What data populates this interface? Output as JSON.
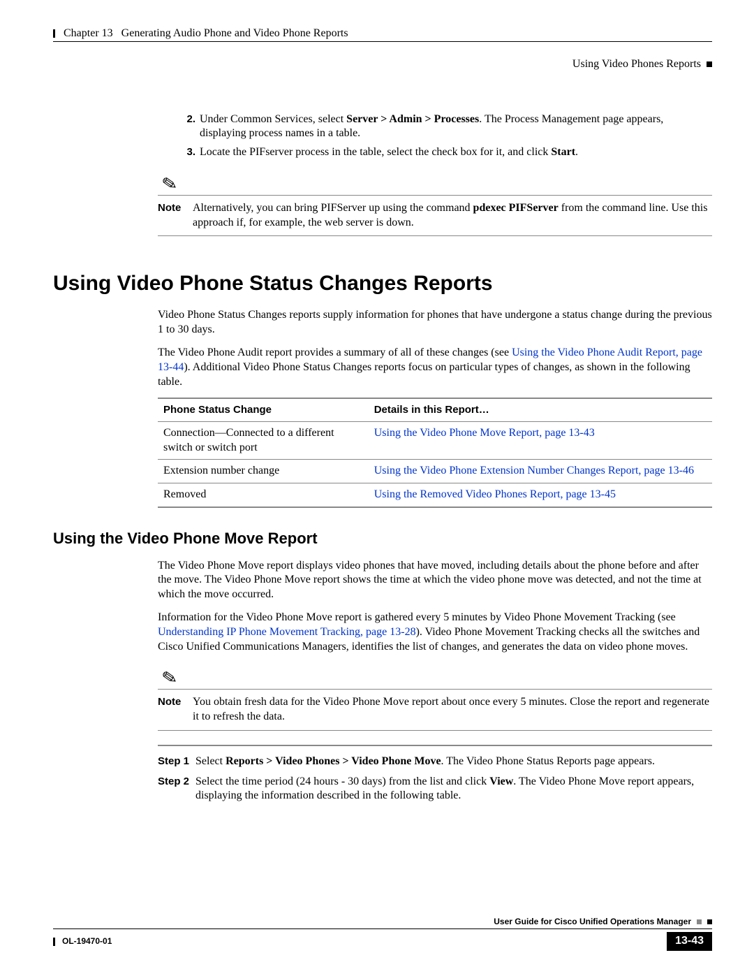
{
  "header": {
    "chapter_label": "Chapter 13",
    "chapter_title": "Generating Audio Phone and Video Phone Reports",
    "section_right": "Using Video Phones Reports"
  },
  "ordered_steps": {
    "s2_num": "2.",
    "s2_pre": "Under Common Services, select ",
    "s2_bold": "Server > Admin > Processes",
    "s2_post": ". The Process Management page appears, displaying process names in a table.",
    "s3_num": "3.",
    "s3_pre": "Locate the PIFserver process in the table, select the check box for it, and click ",
    "s3_bold": "Start",
    "s3_post": "."
  },
  "note1": {
    "label": "Note",
    "text_pre": "Alternatively, you can bring PIFServer up using the command ",
    "text_bold": "pdexec PIFServer",
    "text_post": " from the command line. Use this approach if, for example, the web server is down."
  },
  "h1": "Using Video Phone Status Changes Reports",
  "p1": "Video Phone Status Changes reports supply information for phones that have undergone a status change during the previous 1 to 30 days.",
  "p2_pre": "The Video Phone Audit report provides a summary of all of these changes (see ",
  "p2_link": "Using the Video Phone Audit Report, page 13-44",
  "p2_post": "). Additional Video Phone Status Changes reports focus on particular types of changes, as shown in the following table.",
  "table": {
    "h1": "Phone Status Change",
    "h2": "Details in this Report…",
    "r1c1": "Connection—Connected to a different switch or switch port",
    "r1c2": "Using the Video Phone Move Report, page 13-43",
    "r2c1": "Extension number change",
    "r2c2": "Using the Video Phone Extension Number Changes Report, page 13-46",
    "r3c1": "Removed",
    "r3c2": "Using the Removed Video Phones Report, page 13-45"
  },
  "h2": "Using the Video Phone Move Report",
  "p3": "The Video Phone Move report displays video phones that have moved, including details about the phone before and after the move. The Video Phone Move report shows the time at which the video phone move was detected, and not the time at which the move occurred.",
  "p4_pre": "Information for the Video Phone Move report is gathered every 5 minutes by Video Phone Movement Tracking (see ",
  "p4_link": "Understanding IP Phone Movement Tracking, page 13-28",
  "p4_post": "). Video Phone Movement Tracking checks all the switches and Cisco Unified Communications Managers, identifies the list of changes, and generates the data on video phone moves.",
  "note2": {
    "label": "Note",
    "text": "You obtain fresh data for the Video Phone Move report about once every 5 minutes. Close the report and regenerate it to refresh the data."
  },
  "steps": {
    "s1_label": "Step 1",
    "s1_pre": "Select ",
    "s1_bold": "Reports > Video Phones > Video Phone Move",
    "s1_post": ". The Video Phone Status Reports page appears.",
    "s2_label": "Step 2",
    "s2_pre": "Select the time period (24 hours - 30 days) from the list and click ",
    "s2_bold": "View",
    "s2_post": ". The Video Phone Move report appears, displaying the information described in the following table."
  },
  "footer": {
    "guide": "User Guide for Cisco Unified Operations Manager",
    "docid": "OL-19470-01",
    "pagenum": "13-43"
  }
}
